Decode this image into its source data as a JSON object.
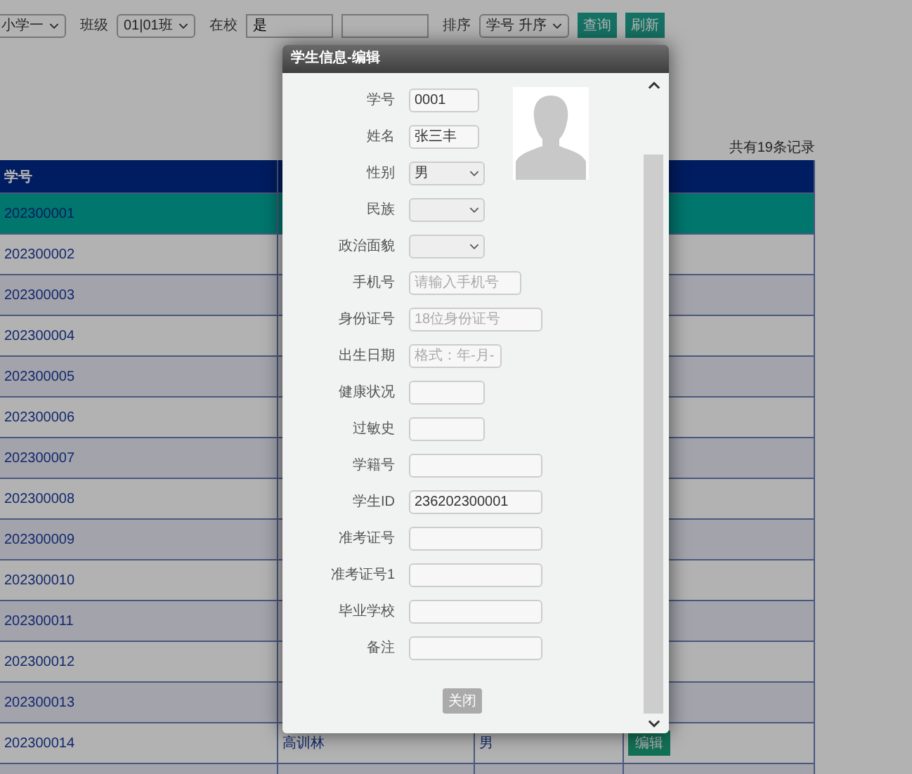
{
  "toolbar": {
    "filters": [
      {
        "kind": "select",
        "value": "小学一"
      },
      {
        "kind": "select",
        "label": "班级",
        "value": "01|01班"
      },
      {
        "kind": "input",
        "label": "在校",
        "value": "是"
      },
      {
        "kind": "input"
      },
      {
        "kind": "select",
        "label": "排序",
        "value": "学号 升序"
      }
    ],
    "buttons": [
      "查询",
      "刷新"
    ]
  },
  "record_count": "共有19条记录",
  "table": {
    "header": "学号",
    "rows": [
      {
        "id": "202300001",
        "selected": true
      },
      {
        "id": "202300002",
        "selected": false
      },
      {
        "id": "202300003",
        "selected": false
      },
      {
        "id": "202300004",
        "selected": false
      },
      {
        "id": "202300005",
        "selected": false
      },
      {
        "id": "202300006",
        "selected": false
      },
      {
        "id": "202300007",
        "selected": false
      },
      {
        "id": "202300008",
        "selected": false
      },
      {
        "id": "202300009",
        "selected": false
      },
      {
        "id": "202300010",
        "selected": false
      },
      {
        "id": "202300011",
        "selected": false
      },
      {
        "id": "202300012",
        "selected": false
      },
      {
        "id": "202300013",
        "selected": false
      },
      {
        "id": "202300014",
        "name": "高训林",
        "gender": "男",
        "action": "编辑",
        "selected": false
      }
    ]
  },
  "dialog": {
    "title": "学生信息-编辑",
    "fields": [
      {
        "label": "学号",
        "kind": "input",
        "value": "0001"
      },
      {
        "label": "姓名",
        "kind": "input",
        "value": "张三丰"
      },
      {
        "label": "性别",
        "kind": "select",
        "value": "男"
      },
      {
        "label": "民族",
        "kind": "select"
      },
      {
        "label": "政治面貌",
        "kind": "select"
      },
      {
        "label": "手机号",
        "kind": "input",
        "placeholder": "请输入手机号"
      },
      {
        "label": "身份证号",
        "kind": "input",
        "placeholder": "18位身份证号"
      },
      {
        "label": "出生日期",
        "kind": "input",
        "placeholder": "格式：年-月-"
      },
      {
        "label": "健康状况",
        "kind": "input"
      },
      {
        "label": "过敏史",
        "kind": "input"
      },
      {
        "label": "学籍号",
        "kind": "input"
      },
      {
        "label": "学生ID",
        "kind": "input",
        "value": "236202300001"
      },
      {
        "label": "准考证号",
        "kind": "input"
      },
      {
        "label": "准考证号1",
        "kind": "input"
      },
      {
        "label": "毕业学校",
        "kind": "input"
      },
      {
        "label": "备注",
        "kind": "input"
      }
    ],
    "close_button": "关闭"
  }
}
